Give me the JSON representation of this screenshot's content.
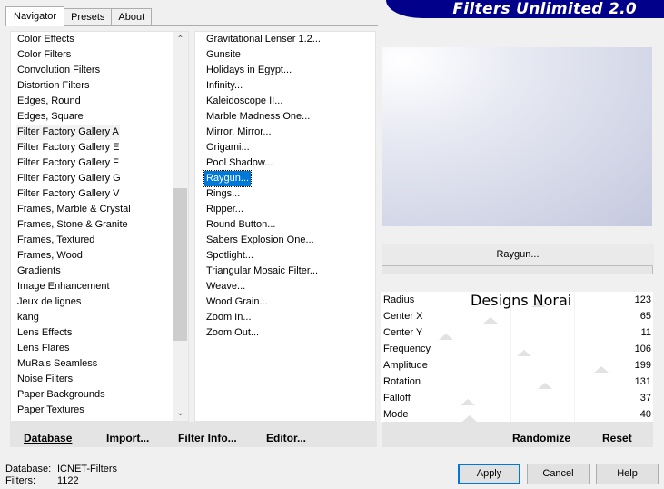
{
  "tabs": [
    "Navigator",
    "Presets",
    "About"
  ],
  "banner_title": "Filters Unlimited 2.0",
  "categories": [
    "Color Effects",
    "Color Filters",
    "Convolution Filters",
    "Distortion Filters",
    "Edges, Round",
    "Edges, Square",
    "Filter Factory Gallery A",
    "Filter Factory Gallery E",
    "Filter Factory Gallery F",
    "Filter Factory Gallery G",
    "Filter Factory Gallery V",
    "Frames, Marble & Crystal",
    "Frames, Stone & Granite",
    "Frames, Textured",
    "Frames, Wood",
    "Gradients",
    "Image Enhancement",
    "Jeux de lignes",
    "kang",
    "Lens Effects",
    "Lens Flares",
    "MuRa's Seamless",
    "Noise Filters",
    "Paper Backgrounds",
    "Paper Textures"
  ],
  "selected_category": "Filter Factory Gallery A",
  "filters": [
    "Gravitational Lenser 1.2...",
    "Gunsite",
    "Holidays in Egypt...",
    "Infinity...",
    "Kaleidoscope II...",
    "Marble Madness One...",
    "Mirror, Mirror...",
    "Origami...",
    "Pool Shadow...",
    "Raygun...",
    "Rings...",
    "Ripper...",
    "Round Button...",
    "Sabers Explosion One...",
    "Spotlight...",
    "Triangular Mosaic Filter...",
    "Weave...",
    "Wood Grain...",
    "Zoom In...",
    "Zoom Out..."
  ],
  "selected_filter": "Raygun...",
  "filter_name": "Raygun...",
  "watermark": "Designs Norai",
  "params": [
    {
      "label": "Radius",
      "value": "123",
      "level": 123
    },
    {
      "label": "Center X",
      "value": "65",
      "level": 65
    },
    {
      "label": "Center Y",
      "value": "11",
      "level": 11
    },
    {
      "label": "Frequency",
      "value": "106",
      "level": 106
    },
    {
      "label": "Amplitude",
      "value": "199",
      "level": 199
    },
    {
      "label": "Rotation",
      "value": "131",
      "level": 131
    },
    {
      "label": "Falloff",
      "value": "37",
      "level": 37
    },
    {
      "label": "Mode",
      "value": "40",
      "level": 40
    }
  ],
  "toolbar": {
    "database": "Database",
    "import": "Import...",
    "filter_info": "Filter Info...",
    "editor": "Editor...",
    "randomize": "Randomize",
    "reset": "Reset"
  },
  "footer": {
    "database_label": "Database:",
    "database_value": "ICNET-Filters",
    "filters_label": "Filters:",
    "filters_value": "1122"
  },
  "buttons": {
    "apply": "Apply",
    "cancel": "Cancel",
    "help": "Help"
  },
  "colors": {
    "banner": "#00008b",
    "selection": "#0078d7"
  }
}
